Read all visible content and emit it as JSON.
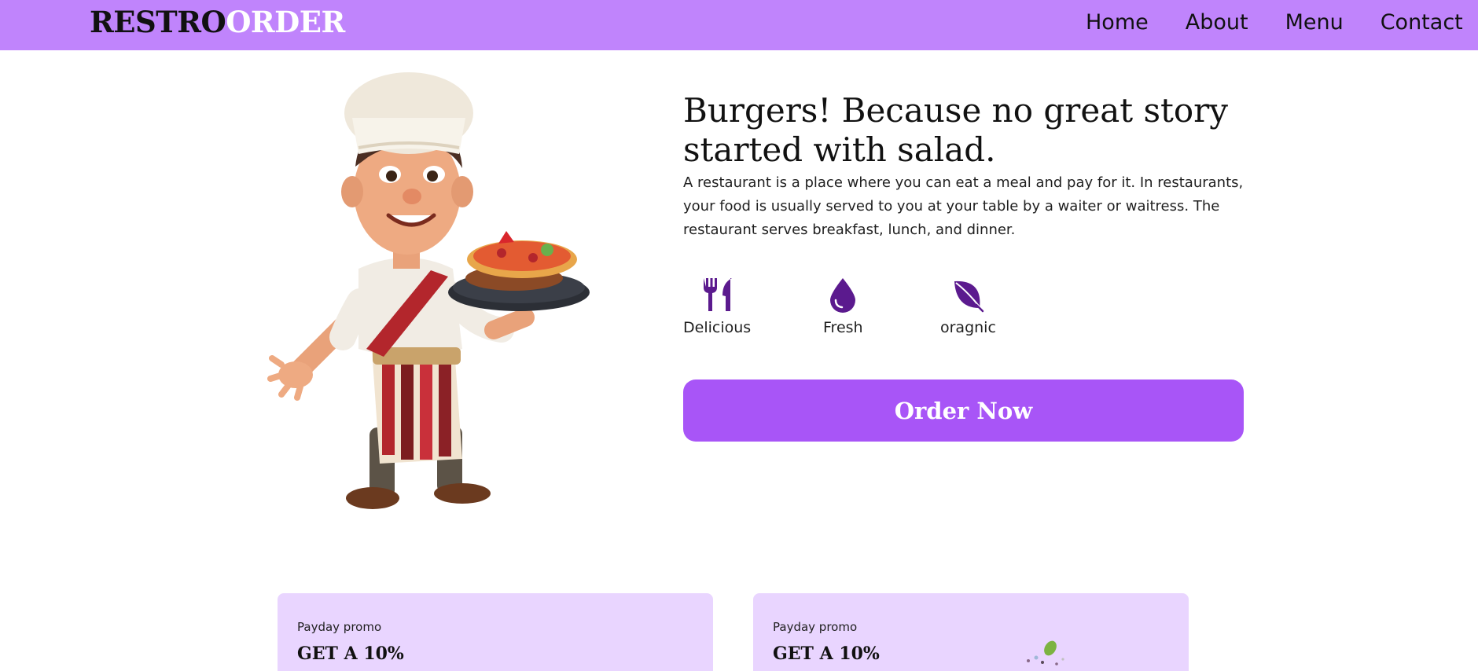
{
  "brand": {
    "part1": "RESTRO",
    "part2": "ORDER"
  },
  "nav": {
    "links": [
      "Home",
      "About",
      "Menu",
      "Contact"
    ]
  },
  "hero": {
    "title": "Burgers! Because no great story started with salad.",
    "description": "A restaurant is a place where you can eat a meal and pay for it. In restaurants, your food is usually served to you at your table by a waiter or waitress. The restaurant serves breakfast, lunch, and dinner.",
    "features": [
      {
        "icon": "fork-knife-icon",
        "label": "Delicious"
      },
      {
        "icon": "drop-icon",
        "label": "Fresh"
      },
      {
        "icon": "leaf-icon",
        "label": "oragnic"
      }
    ],
    "cta_label": "Order Now"
  },
  "promos": [
    {
      "small": "Payday promo",
      "big": "GET A 10%"
    },
    {
      "small": "Payday promo",
      "big": "GET A 10%"
    }
  ],
  "colors": {
    "navbar": "#c084fc",
    "button": "#a855f7",
    "icon": "#5b1a8e",
    "promo_card": "#e9d5ff"
  }
}
